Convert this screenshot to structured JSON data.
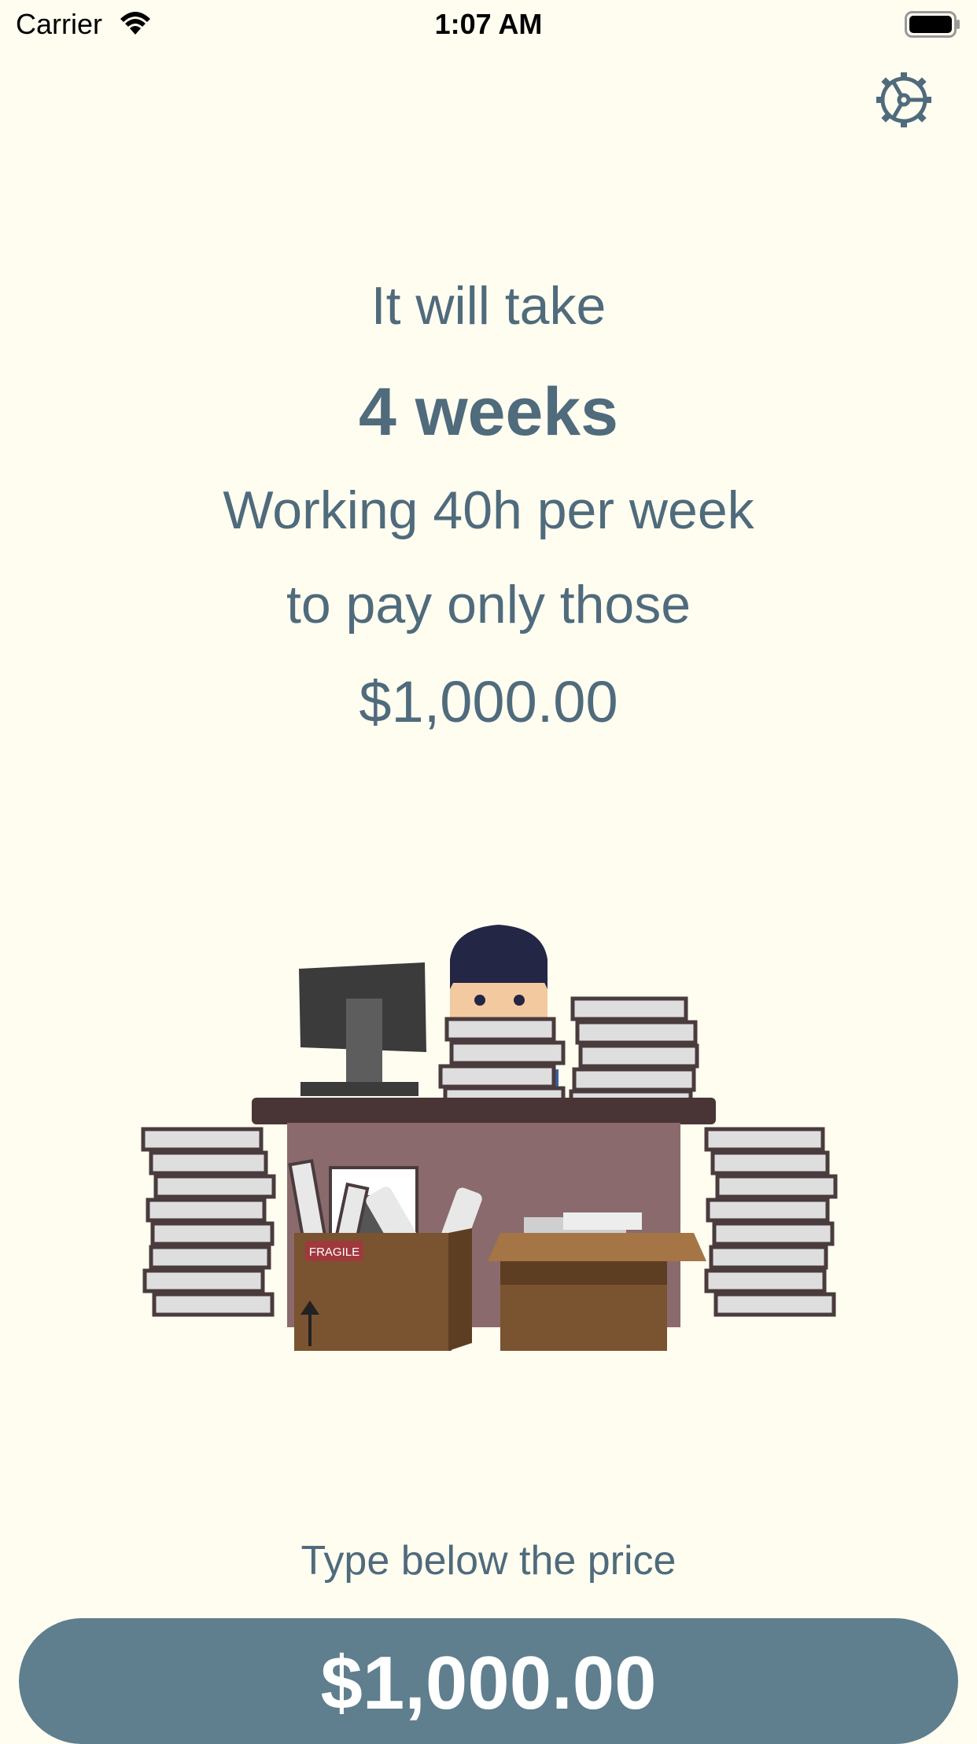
{
  "status_bar": {
    "carrier": "Carrier",
    "time": "1:07 AM"
  },
  "message": {
    "line1": "It will take",
    "duration": "4 weeks",
    "line3": "Working 40h per week",
    "line4": "to pay only those",
    "amount": "$1,000.00"
  },
  "illustration": {
    "box_label": "FRAGILE"
  },
  "input": {
    "prompt": "Type below the price",
    "value": "$1,000.00"
  },
  "colors": {
    "background": "#fffdf0",
    "text": "#4f6b7c",
    "input_background": "#5f7e8e"
  },
  "icons": {
    "settings": "gear-icon",
    "wifi": "wifi-icon",
    "battery": "battery-icon"
  }
}
